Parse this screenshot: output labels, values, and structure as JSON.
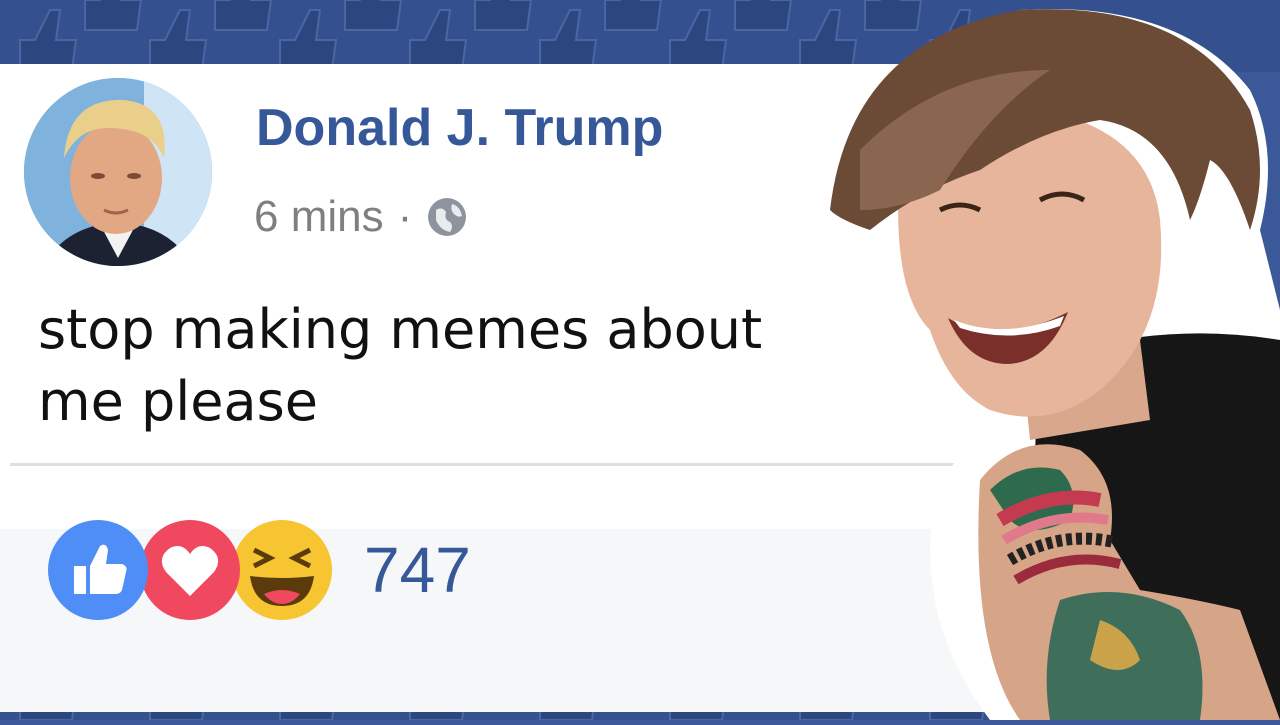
{
  "post": {
    "author": "Donald J. Trump",
    "time": "6 mins",
    "separator": "·",
    "privacy_icon": "globe-icon",
    "text_line1": "stop making memes about",
    "text_line2": "me please"
  },
  "reactions": {
    "icons": [
      "like-icon",
      "love-icon",
      "haha-icon"
    ],
    "count": "747"
  },
  "colors": {
    "facebook_blue": "#3b5998",
    "name_blue": "#365899",
    "like_blue": "#4f8ef7",
    "love_red": "#f0485f",
    "haha_yellow": "#f7c531"
  }
}
